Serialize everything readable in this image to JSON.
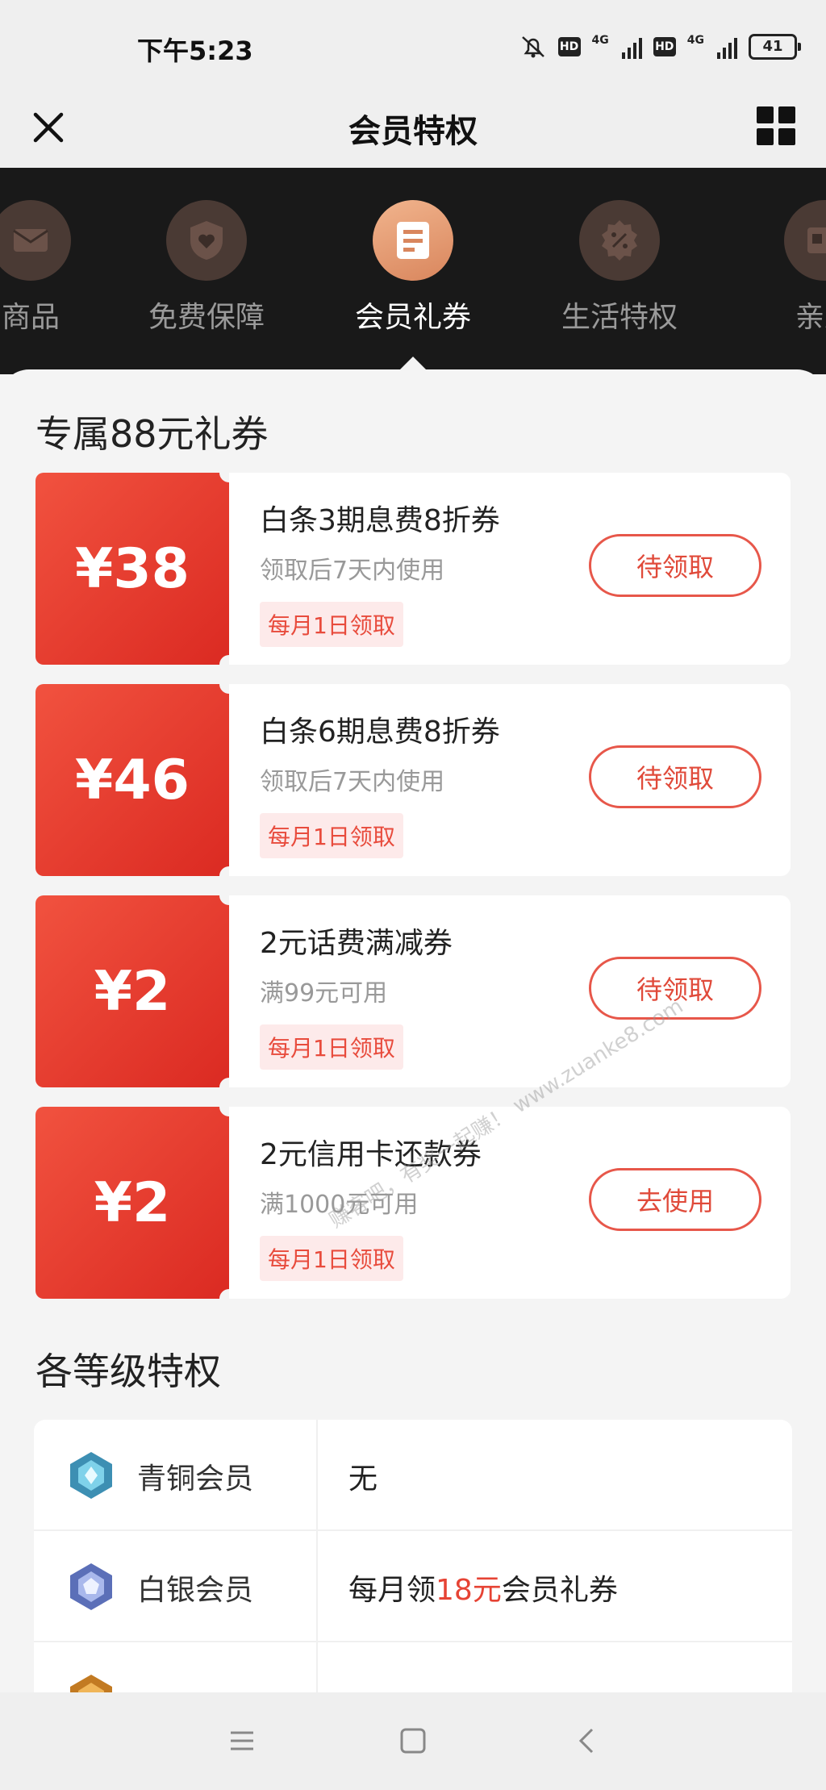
{
  "status_bar": {
    "time": "下午5:23",
    "network_1": "4G",
    "network_2": "4G",
    "hd_label": "HD",
    "battery": "41"
  },
  "nav": {
    "title": "会员特权",
    "icons": {
      "close": "close-icon",
      "menu": "grid-menu-icon"
    }
  },
  "category_tabs": [
    {
      "label": "商品",
      "icon": "mail-icon",
      "active": false
    },
    {
      "label": "免费保障",
      "icon": "heart-shield-icon",
      "active": false
    },
    {
      "label": "会员礼券",
      "icon": "coupon-icon",
      "active": true
    },
    {
      "label": "生活特权",
      "icon": "discount-badge-icon",
      "active": false
    },
    {
      "label": "亲友",
      "icon": "card-icon",
      "active": false
    }
  ],
  "coupons_section": {
    "title": "专属88元礼券",
    "items": [
      {
        "amount": "¥38",
        "name": "白条3期息费8折券",
        "condition": "领取后7天内使用",
        "tag": "每月1日领取",
        "button": "待领取"
      },
      {
        "amount": "¥46",
        "name": "白条6期息费8折券",
        "condition": "领取后7天内使用",
        "tag": "每月1日领取",
        "button": "待领取"
      },
      {
        "amount": "¥2",
        "name": "2元话费满减券",
        "condition": "满99元可用",
        "tag": "每月1日领取",
        "button": "待领取"
      },
      {
        "amount": "¥2",
        "name": "2元信用卡还款券",
        "condition": "满1000元可用",
        "tag": "每月1日领取",
        "button": "去使用"
      }
    ]
  },
  "tiers_section": {
    "title": "各等级特权",
    "rows": [
      {
        "name": "青铜会员",
        "icon": "bronze-gem-icon",
        "benefit_prefix": "无",
        "benefit_highlight": "",
        "benefit_suffix": ""
      },
      {
        "name": "白银会员",
        "icon": "silver-gem-icon",
        "benefit_prefix": "每月领",
        "benefit_highlight": "18元",
        "benefit_suffix": "会员礼券"
      }
    ]
  },
  "watermark": "赚客吧，有奖一起赚！ www.zuanke8.com",
  "colors": {
    "accent_red": "#e64334",
    "coupon_red": "#e8352a",
    "dark_strip": "#191919"
  }
}
